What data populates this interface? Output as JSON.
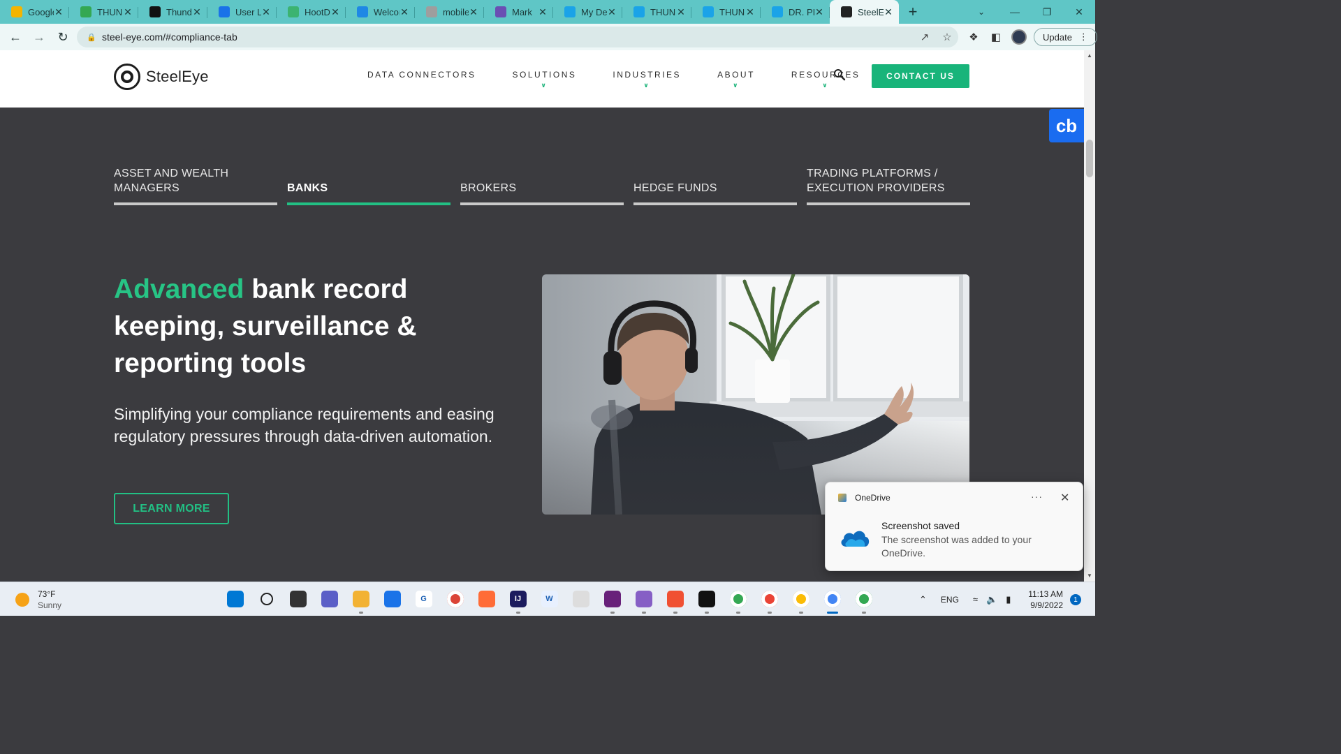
{
  "browser": {
    "tabs": [
      {
        "title": "Google Slides",
        "favicon": "slides-icon",
        "color": "#f4b400",
        "letter": ""
      },
      {
        "title": "THUNDER",
        "favicon": "drive-icon",
        "color": "#34a853",
        "letter": ""
      },
      {
        "title": "Thunder",
        "favicon": "d-icon",
        "color": "#111111",
        "letter": "D"
      },
      {
        "title": "User Li",
        "favicon": "blue-gear-icon",
        "color": "#1a73e8",
        "letter": ""
      },
      {
        "title": "HootD",
        "favicon": "owl-icon",
        "color": "#3cb371",
        "letter": ""
      },
      {
        "title": "Welcome",
        "favicon": "puzzle-icon",
        "color": "#1e88e5",
        "letter": ""
      },
      {
        "title": "mobile",
        "favicon": "globe-icon",
        "color": "#9e9e9e",
        "letter": ""
      },
      {
        "title": "Mark",
        "favicon": "shield-icon",
        "color": "#6a4fb3",
        "letter": ""
      },
      {
        "title": "My De",
        "favicon": "circle-icon",
        "color": "#1aa3e8",
        "letter": ""
      },
      {
        "title": "THUNDER",
        "favicon": "circle-icon",
        "color": "#1aa3e8",
        "letter": ""
      },
      {
        "title": "THUNDER",
        "favicon": "circle-icon",
        "color": "#1aa3e8",
        "letter": ""
      },
      {
        "title": "DR. PI",
        "favicon": "circle-icon",
        "color": "#1aa3e8",
        "letter": ""
      },
      {
        "title": "SteelEye",
        "favicon": "steeleye-icon",
        "color": "#222222",
        "letter": "",
        "active": true
      }
    ],
    "url": "steel-eye.com/#compliance-tab",
    "update_label": "Update"
  },
  "site": {
    "logo_text": "SteelEye",
    "nav": [
      {
        "label": "DATA CONNECTORS",
        "dropdown": false
      },
      {
        "label": "SOLUTIONS",
        "dropdown": true
      },
      {
        "label": "INDUSTRIES",
        "dropdown": true
      },
      {
        "label": "ABOUT",
        "dropdown": true
      },
      {
        "label": "RESOURCES",
        "dropdown": true
      }
    ],
    "contact_label": "CONTACT US",
    "accent_color": "#1bb37a"
  },
  "cb_badge": "cb",
  "segments": [
    {
      "label_lines": [
        "ASSET AND WEALTH",
        "MANAGERS"
      ],
      "active": false
    },
    {
      "label_lines": [
        "BANKS"
      ],
      "active": true
    },
    {
      "label_lines": [
        "BROKERS"
      ],
      "active": false
    },
    {
      "label_lines": [
        "HEDGE FUNDS"
      ],
      "active": false
    },
    {
      "label_lines": [
        "TRADING PLATFORMS /",
        "EXECUTION PROVIDERS"
      ],
      "active": false
    }
  ],
  "hero": {
    "headline_accent": "Advanced",
    "headline_rest": " bank record keeping, surveillance & reporting tools",
    "subtitle": "Simplifying your compliance requirements and easing regulatory pressures through data-driven automation.",
    "cta_label": "LEARN MORE"
  },
  "toast": {
    "app_name": "OneDrive",
    "title": "Screenshot saved",
    "body": "The screenshot was added to your OneDrive."
  },
  "taskbar": {
    "temperature": "73°F",
    "condition": "Sunny",
    "language": "ENG",
    "time": "11:13 AM",
    "date": "9/9/2022",
    "notification_count": "1",
    "apps": [
      {
        "name": "start-icon",
        "color": "#0078d4",
        "label": "",
        "running": false
      },
      {
        "name": "search-icon",
        "color": "transparent",
        "label": "",
        "running": false
      },
      {
        "name": "task-view-icon",
        "color": "#333333",
        "label": "",
        "running": false
      },
      {
        "name": "teams-chat-icon",
        "color": "#5b5fc7",
        "label": "",
        "running": false
      },
      {
        "name": "file-explorer-icon",
        "color": "#f2b233",
        "label": "",
        "running": true
      },
      {
        "name": "mail-icon",
        "color": "#1a73e8",
        "label": "",
        "running": false
      },
      {
        "name": "grammarly-icon",
        "color": "#ffffff",
        "label": "G",
        "running": false
      },
      {
        "name": "chrome-icon",
        "color": "#db4437",
        "label": "",
        "running": false
      },
      {
        "name": "postman-icon",
        "color": "#ff6c37",
        "label": "",
        "running": false
      },
      {
        "name": "intellij-icon",
        "color": "#1c1c5e",
        "label": "IJ",
        "running": true
      },
      {
        "name": "word-icon",
        "color": "#e8f0fe",
        "label": "W",
        "running": false
      },
      {
        "name": "unity-icon",
        "color": "#dddddd",
        "label": "",
        "running": false
      },
      {
        "name": "visual-studio-icon",
        "color": "#68217a",
        "label": "",
        "running": true
      },
      {
        "name": "visual-studio-icon-2",
        "color": "#865fc5",
        "label": "",
        "running": true
      },
      {
        "name": "sourcetree-icon",
        "color": "#f05032",
        "label": "",
        "running": true
      },
      {
        "name": "terminal-icon",
        "color": "#111111",
        "label": "",
        "running": true
      },
      {
        "name": "chrome-profile-1-icon",
        "color": "#34a853",
        "label": "",
        "running": true
      },
      {
        "name": "chrome-profile-2-icon",
        "color": "#ea4335",
        "label": "",
        "running": true
      },
      {
        "name": "chrome-profile-3-icon",
        "color": "#fbbc05",
        "label": "",
        "running": true
      },
      {
        "name": "chrome-profile-4-icon",
        "color": "#4285f4",
        "label": "",
        "running": true,
        "active": true
      },
      {
        "name": "chrome-profile-5-icon",
        "color": "#34a853",
        "label": "",
        "running": true
      }
    ]
  }
}
